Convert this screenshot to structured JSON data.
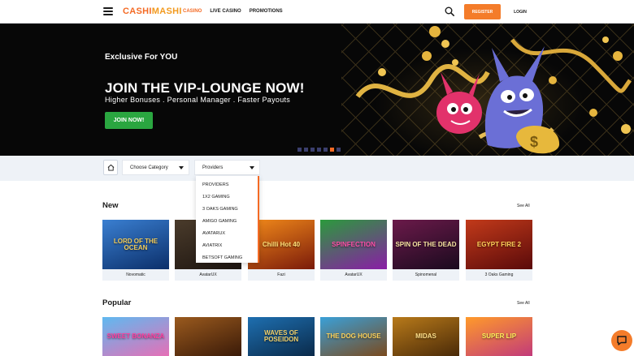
{
  "header": {
    "logo_part1": "CASHI",
    "logo_part2": "MASHI",
    "nav": [
      "CASINO",
      "LIVE CASINO",
      "PROMOTIONS"
    ],
    "register_label": "REGISTER",
    "login_label": "LOGIN"
  },
  "hero": {
    "subtitle": "Exclusive For YOU",
    "title": "JOIN THE VIP-LOUNGE NOW!",
    "description": "Higher Bonuses . Personal Manager . Faster Payouts",
    "cta_label": "JOIN NOW!",
    "slides_count": 7,
    "active_slide": 6
  },
  "filters": {
    "category_label": "Choose Category",
    "providers_label": "Providers",
    "provider_options": [
      "PROVIDERS",
      "1X2 GAMING",
      "3 OAKS GAMING",
      "AMIGO GAMING",
      "AVATARUX",
      "AVIATRIX",
      "BETSOFT GAMING"
    ]
  },
  "sections": {
    "new": {
      "title": "New",
      "see_all": "See All",
      "games": [
        {
          "title": "LORD OF THE OCEAN",
          "provider": "Novomatic"
        },
        {
          "title": "",
          "provider": "AvatarUX"
        },
        {
          "title": "Chilli Hot 40",
          "provider": "Fazi"
        },
        {
          "title": "SPINFECTION",
          "provider": "AvatarUX"
        },
        {
          "title": "SPIN OF THE DEAD",
          "provider": "Spinomenal"
        },
        {
          "title": "EGYPT FIRE 2",
          "provider": "3 Oaks Gaming"
        }
      ]
    },
    "popular": {
      "title": "Popular",
      "see_all": "See All",
      "games": [
        {
          "title": "SWEET BONANZA"
        },
        {
          "title": ""
        },
        {
          "title": "WAVES OF POSEIDON"
        },
        {
          "title": "THE DOG HOUSE"
        },
        {
          "title": "MIDAS"
        },
        {
          "title": "SUPER LIP"
        }
      ]
    }
  },
  "colors": {
    "accent": "#f46a24",
    "cta_green": "#2aa640",
    "hero_bg": "#070707"
  },
  "icons": {
    "menu": "hamburger-icon",
    "search": "search-icon",
    "home": "home-icon",
    "chat": "chat-icon"
  }
}
